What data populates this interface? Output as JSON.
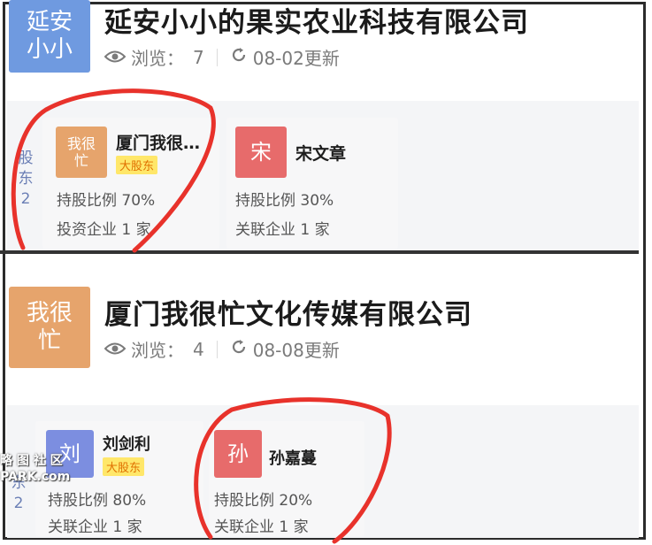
{
  "section1": {
    "logo_text": "延安\n小小",
    "company_name": "延安小小的果实农业科技有限公司",
    "views_label": "浏览：",
    "views_count": "7",
    "updated": "08-02更新",
    "shareholders_label": "股\n东\n2",
    "shareholders": [
      {
        "avatar_text": "我很\n忙",
        "name": "厦门我很…",
        "badge": "大股东",
        "ratio": "持股比例 70%",
        "related": "投资企业 1 家"
      },
      {
        "avatar_text": "宋",
        "name": "宋文章",
        "ratio": "持股比例 30%",
        "related": "关联企业 1 家"
      }
    ]
  },
  "section2": {
    "logo_text": "我很\n忙",
    "company_name": "厦门我很忙文化传媒有限公司",
    "views_label": "浏览：",
    "views_count": "4",
    "updated": "08-08更新",
    "shareholders_label": "东\n2",
    "shareholders": [
      {
        "avatar_text": "刘",
        "name": "刘剑利",
        "badge": "大股东",
        "ratio": "持股比例 80%",
        "related": "关联企业 1 家"
      },
      {
        "avatar_text": "孙",
        "name": "孙嘉蔓",
        "ratio": "持股比例 20%",
        "related": "关联企业 1 家"
      }
    ]
  },
  "watermark": {
    "line1": "略 图 社 区",
    "line2": "PARK.com"
  },
  "colors": {
    "logo_blue": "#6f9ae0",
    "logo_orange": "#e6a46c",
    "avatar_red": "#e76b6b",
    "avatar_blue": "#7c8ee0",
    "badge_yellow": "#ffe76a",
    "circle_red": "#e8322b"
  }
}
